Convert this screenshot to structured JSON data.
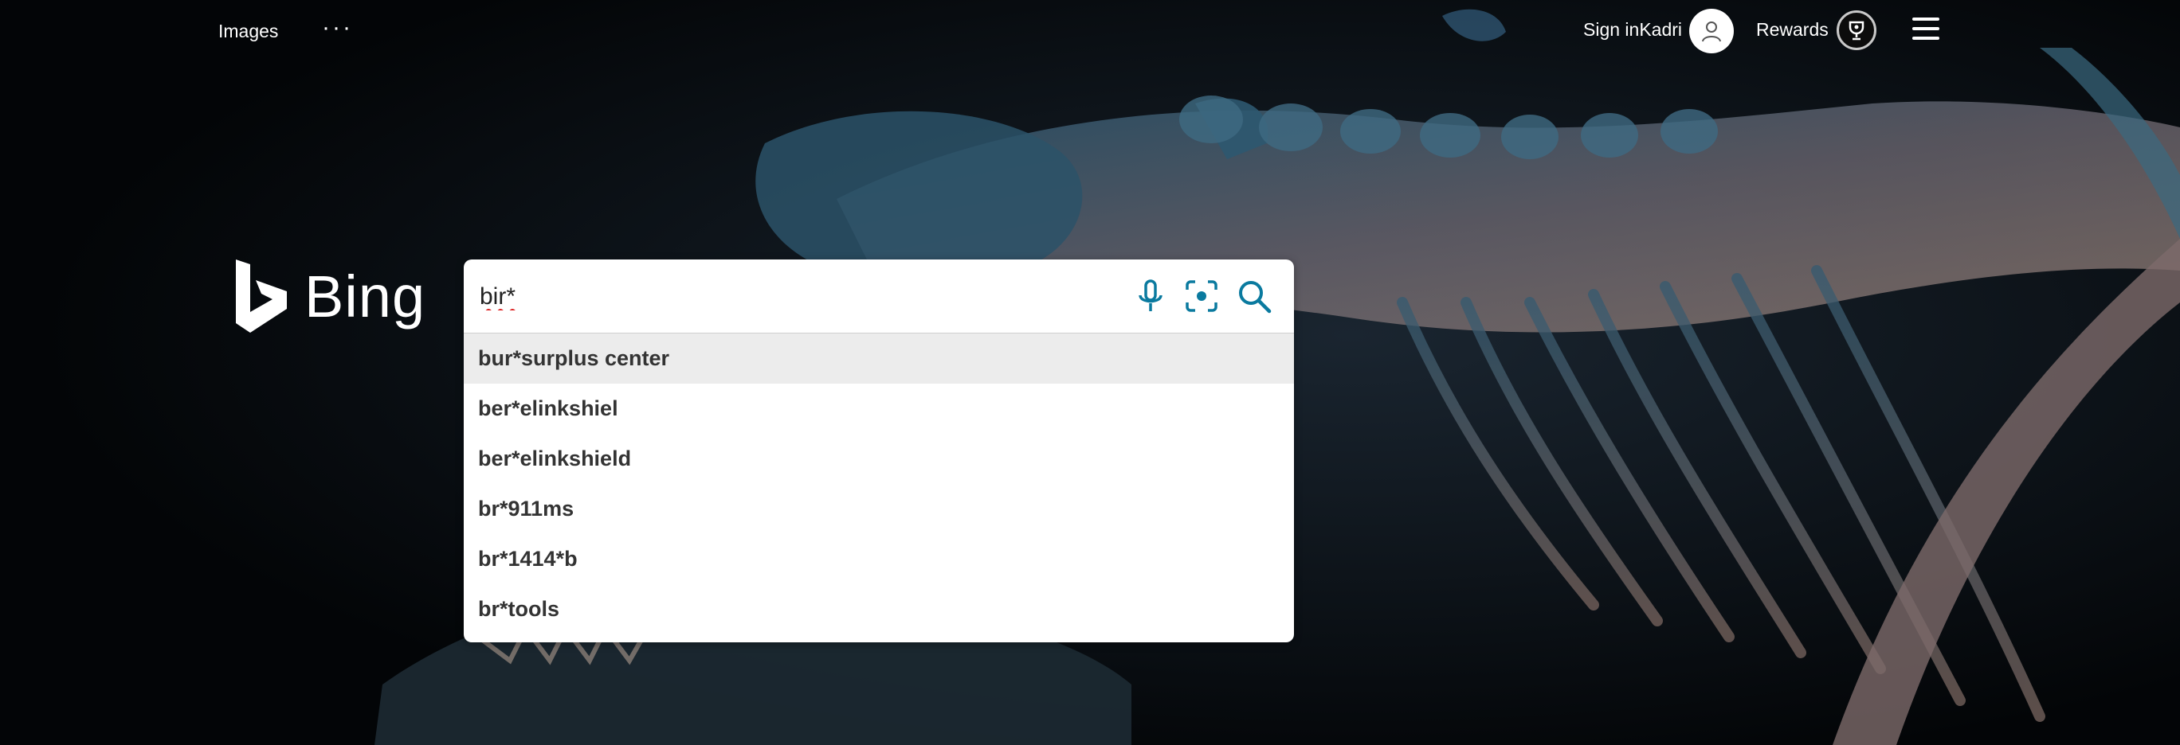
{
  "header": {
    "images_label": "Images",
    "more_label": "···",
    "signin_label": "Sign inKadri",
    "rewards_label": "Rewards"
  },
  "logo": {
    "text": "Bing"
  },
  "search": {
    "value": "bir*",
    "suggestions": [
      {
        "label": "bur*surplus center"
      },
      {
        "label": "ber*elinkshiel"
      },
      {
        "label": "ber*elinkshield"
      },
      {
        "label": "br*911ms"
      },
      {
        "label": "br*1414*b"
      },
      {
        "label": "br*tools"
      }
    ]
  },
  "colors": {
    "accent": "#0a7a9f",
    "bone_dark": "#1f3a4a",
    "bone_light": "#8a7a78"
  },
  "icons": [
    "dots-icon",
    "user-icon",
    "trophy-icon",
    "hamburger-icon",
    "bing-logo-icon",
    "mic-icon",
    "visual-search-icon",
    "search-icon"
  ]
}
